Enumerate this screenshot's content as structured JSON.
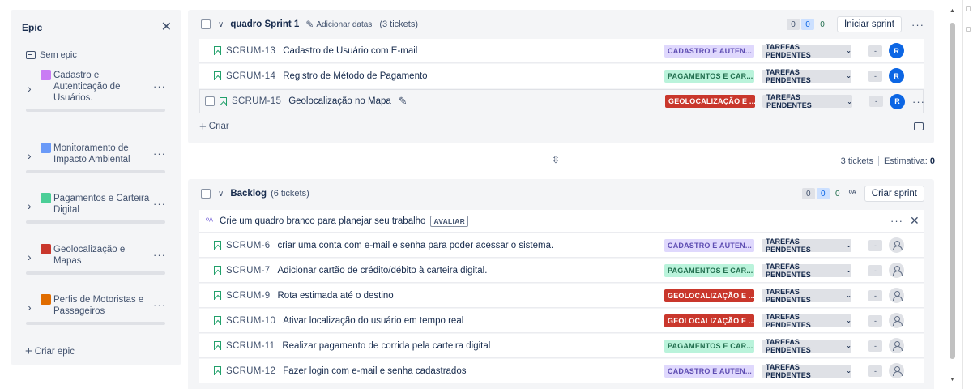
{
  "epic_panel": {
    "title": "Epic",
    "no_epic": "Sem epic",
    "create_label": "Criar epic",
    "epics": [
      {
        "lines": [
          "Cadastro e",
          "Autenticação de",
          "Usuários."
        ],
        "color": "#c97cf4"
      },
      {
        "lines": [
          "Monitoramento de",
          "Impacto Ambiental"
        ],
        "color": "#6a9af8"
      },
      {
        "lines": [
          "Pagamentos e Carteira",
          "Digital"
        ],
        "color": "#4bce97"
      },
      {
        "lines": [
          "Geolocalização e",
          "Mapas"
        ],
        "color": "#c9372c"
      },
      {
        "lines": [
          "Perfis de Motoristas e",
          "Passageiros"
        ],
        "color": "#e06c00"
      }
    ]
  },
  "sprint": {
    "title": "quadro Sprint 1",
    "add_dates": "Adicionar datas",
    "ticket_count": "(3 tickets)",
    "counts": [
      "0",
      "0",
      "0"
    ],
    "start_button": "Iniciar sprint",
    "create_label": "Criar",
    "issues": [
      {
        "key": "SCRUM-13",
        "summary": "Cadastro de Usuário com E-mail",
        "epic": "CADASTRO E AUTEN...",
        "epic_style": "purple",
        "status": "TAREFAS PENDENTES",
        "estimate": "-",
        "assignee": "R"
      },
      {
        "key": "SCRUM-14",
        "summary": "Registro de Método de Pagamento",
        "epic": "PAGAMENTOS E CAR...",
        "epic_style": "green",
        "status": "TAREFAS PENDENTES",
        "estimate": "-",
        "assignee": "R"
      },
      {
        "key": "SCRUM-15",
        "summary": "Geolocalização no Mapa",
        "epic": "GEOLOCALIZAÇÃO E ...",
        "epic_style": "red",
        "status": "TAREFAS PENDENTES",
        "estimate": "-",
        "assignee": "R"
      }
    ]
  },
  "summary": {
    "tickets": "3 tickets",
    "estimate_label": "Estimativa:",
    "estimate_value": "0"
  },
  "backlog": {
    "title": "Backlog",
    "ticket_count": "(6 tickets)",
    "counts": [
      "0",
      "0",
      "0"
    ],
    "create_sprint_button": "Criar sprint",
    "banner_text": "Crie um quadro branco para planejar seu trabalho",
    "banner_badge": "AVALIAR",
    "issues": [
      {
        "key": "SCRUM-6",
        "summary": "criar uma conta com e-mail e senha para poder acessar o sistema.",
        "epic": "CADASTRO E AUTEN...",
        "epic_style": "purple",
        "status": "TAREFAS PENDENTES",
        "estimate": "-"
      },
      {
        "key": "SCRUM-7",
        "summary": "Adicionar cartão de crédito/débito à carteira digital.",
        "epic": "PAGAMENTOS E CAR...",
        "epic_style": "green",
        "status": "TAREFAS PENDENTES",
        "estimate": "-"
      },
      {
        "key": "SCRUM-9",
        "summary": "Rota estimada até o destino",
        "epic": "GEOLOCALIZAÇÃO E ...",
        "epic_style": "red",
        "status": "TAREFAS PENDENTES",
        "estimate": "-"
      },
      {
        "key": "SCRUM-10",
        "summary": "Ativar localização do usuário em tempo real",
        "epic": "GEOLOCALIZAÇÃO E ...",
        "epic_style": "red",
        "status": "TAREFAS PENDENTES",
        "estimate": "-"
      },
      {
        "key": "SCRUM-11",
        "summary": "Realizar pagamento de corrida pela carteira digital",
        "epic": "PAGAMENTOS E CAR...",
        "epic_style": "green",
        "status": "TAREFAS PENDENTES",
        "estimate": "-"
      },
      {
        "key": "SCRUM-12",
        "summary": "Fazer login com e-mail e senha cadastrados",
        "epic": "CADASTRO E AUTEN...",
        "epic_style": "purple",
        "status": "TAREFAS PENDENTES",
        "estimate": "-"
      }
    ]
  },
  "icons": {
    "close": "close-icon",
    "story": "story-icon",
    "edit": "edit-icon",
    "more": "more-icon",
    "drag": "drag-handle-icon",
    "person": "person-icon",
    "whiteboard": "whiteboard-icon"
  }
}
